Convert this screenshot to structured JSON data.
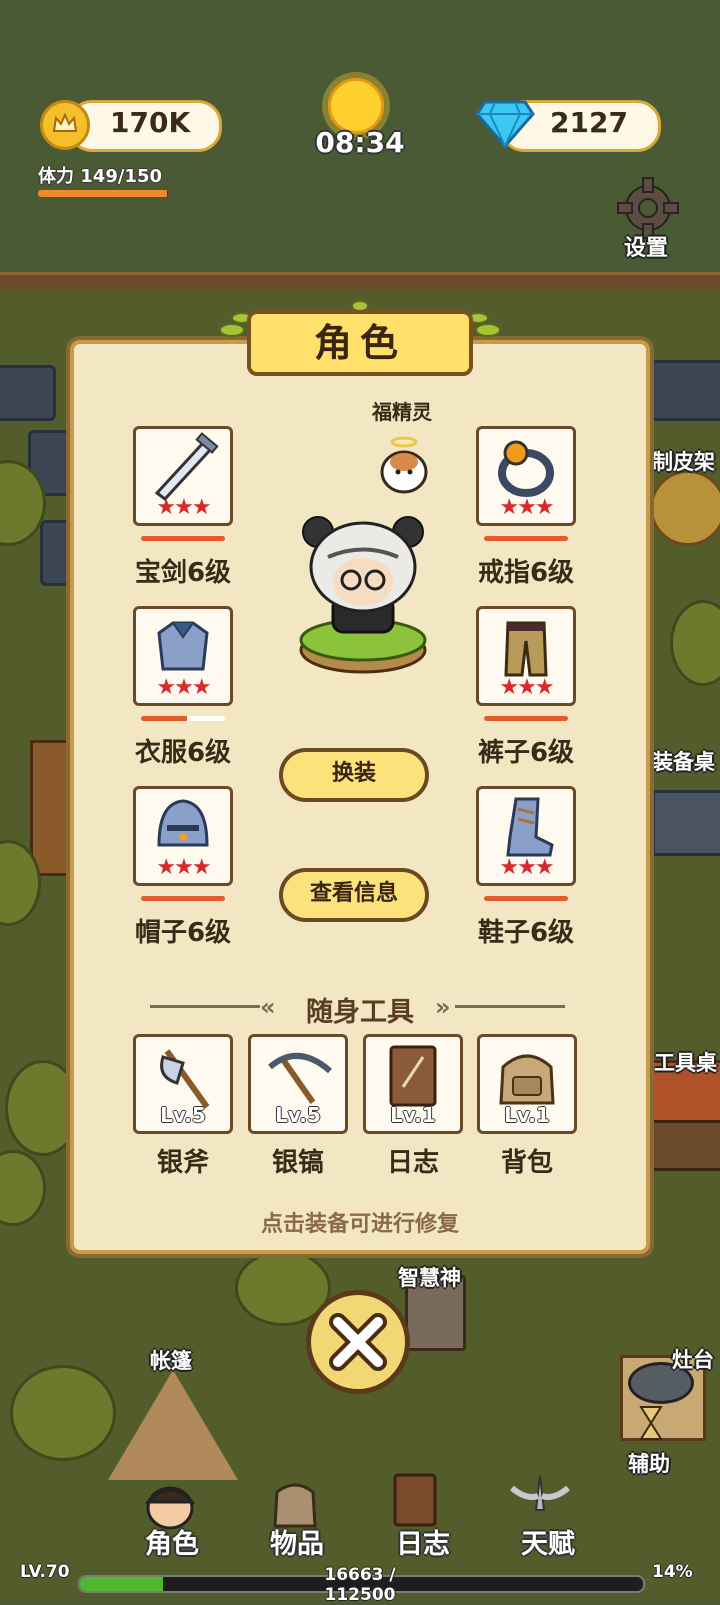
{
  "hud": {
    "gold": "170K",
    "diamonds": "2127",
    "clock": "08:34",
    "stamina_label": "体力",
    "stamina_value": "149/150",
    "stamina_fraction": 0.993,
    "settings_label": "设置"
  },
  "world_labels": {
    "leather": "制皮架",
    "equip_table": "装备桌",
    "tool_table": "工具桌",
    "wisdom": "智慧神",
    "tent": "帐篷",
    "stove": "灶台",
    "assist": "辅助"
  },
  "panel": {
    "title": "角色",
    "pet_label": "福精灵",
    "equipment": [
      {
        "label": "宝剑6级",
        "icon": "sword-icon",
        "stars": "★★★",
        "durability": 1.0
      },
      {
        "label": "戒指6级",
        "icon": "ring-icon",
        "stars": "★★★",
        "durability": 1.0
      },
      {
        "label": "衣服6级",
        "icon": "armor-icon",
        "stars": "★★★",
        "durability": 0.55
      },
      {
        "label": "裤子6级",
        "icon": "pants-icon",
        "stars": "★★★",
        "durability": 1.0
      },
      {
        "label": "帽子6级",
        "icon": "helmet-icon",
        "stars": "★★★",
        "durability": 1.0
      },
      {
        "label": "鞋子6级",
        "icon": "boots-icon",
        "stars": "★★★",
        "durability": 1.0
      }
    ],
    "change_outfit": "换装",
    "view_info": "查看信息",
    "tools_title": "随身工具",
    "tools": [
      {
        "label": "银斧",
        "level": "Lv.5",
        "icon": "axe-icon"
      },
      {
        "label": "银镐",
        "level": "Lv.5",
        "icon": "pickaxe-icon"
      },
      {
        "label": "日志",
        "level": "Lv.1",
        "icon": "journal-icon"
      },
      {
        "label": "背包",
        "level": "Lv.1",
        "icon": "backpack-icon"
      }
    ],
    "hint": "点击装备可进行修复"
  },
  "bottom_tabs": [
    {
      "label": "角色",
      "icon": "character-icon"
    },
    {
      "label": "物品",
      "icon": "items-icon"
    },
    {
      "label": "日志",
      "icon": "journal-icon"
    },
    {
      "label": "天赋",
      "icon": "talent-icon"
    }
  ],
  "xp": {
    "level": "LV.70",
    "progress_text": "16663 / 112500",
    "percent": "14%",
    "fraction": 0.148
  },
  "colors": {
    "panel_bg": "#f3e7c3",
    "accent_yellow": "#fbe27a",
    "star_red": "#d8292e",
    "durability": "#e45a2a",
    "xp_green": "#4fb82e"
  }
}
